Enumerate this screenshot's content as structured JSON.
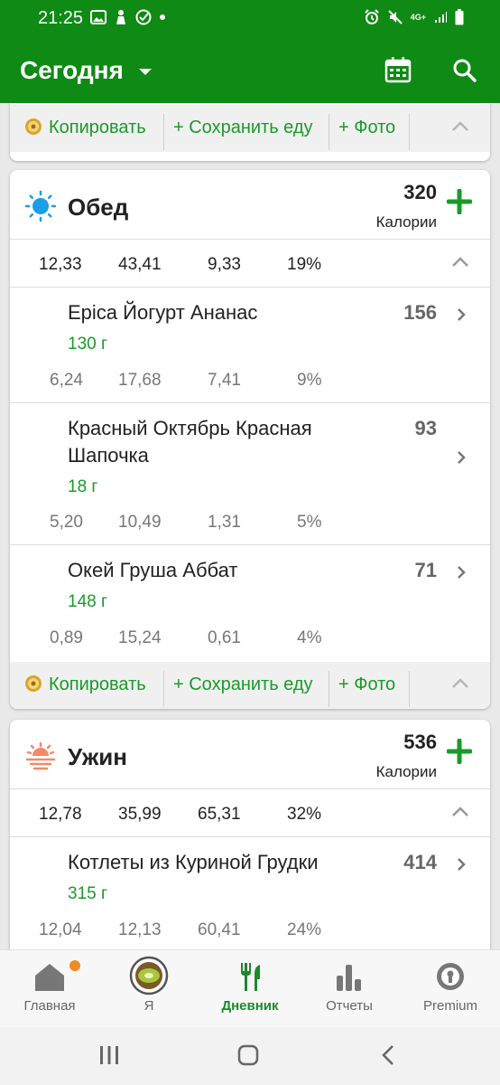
{
  "status_bar": {
    "time": "21:25",
    "network": "4G+"
  },
  "app_bar": {
    "title": "Сегодня"
  },
  "top_actions": {
    "copy": "Копировать",
    "save": "+ Сохранить еду",
    "photo": "+ Фото"
  },
  "lunch": {
    "title": "Обед",
    "calories": "320",
    "calories_label": "Калории",
    "summary": [
      "12,33",
      "43,41",
      "9,33",
      "19%"
    ],
    "items": [
      {
        "name": "Epica Йогурт Ананас",
        "amount": "130 г",
        "calories": "156",
        "macros": [
          "6,24",
          "17,68",
          "7,41",
          "9%"
        ]
      },
      {
        "name": "Красный Октябрь Красная Шапочка",
        "amount": "18 г",
        "calories": "93",
        "macros": [
          "5,20",
          "10,49",
          "1,31",
          "5%"
        ]
      },
      {
        "name": "Окей Груша Аббат",
        "amount": "148 г",
        "calories": "71",
        "macros": [
          "0,89",
          "15,24",
          "0,61",
          "4%"
        ]
      }
    ],
    "actions": {
      "copy": "Копировать",
      "save": "+ Сохранить еду",
      "photo": "+ Фото"
    }
  },
  "dinner": {
    "title": "Ужин",
    "calories": "536",
    "calories_label": "Калории",
    "summary": [
      "12,78",
      "35,99",
      "65,31",
      "32%"
    ],
    "items": [
      {
        "name": "Котлеты из Куриной Грудки",
        "amount": "315 г",
        "calories": "414",
        "macros": [
          "12,04",
          "12,13",
          "60,41",
          "24%"
        ]
      }
    ]
  },
  "bottom_nav": {
    "items": [
      {
        "label": "Главная"
      },
      {
        "label": "Я"
      },
      {
        "label": "Дневник"
      },
      {
        "label": "Отчеты"
      },
      {
        "label": "Premium"
      }
    ]
  },
  "colors": {
    "primary": "#0f8a14",
    "accent_green": "#1a9a2a",
    "notification": "#f08a24",
    "sun": "#1a9ee8",
    "sunset": "#f08a6a"
  }
}
